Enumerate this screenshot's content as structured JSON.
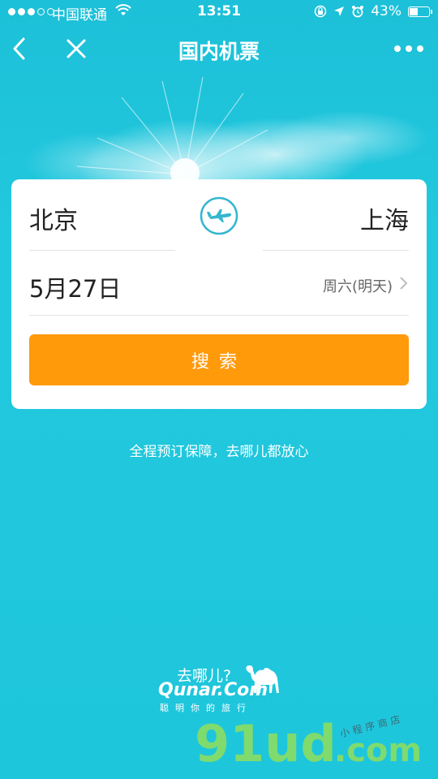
{
  "status_bar": {
    "carrier": "中国联通",
    "time": "13:51",
    "battery": "43%",
    "icons": [
      "signal-icon",
      "wifi-icon",
      "lock-rotation-icon",
      "location-icon",
      "alarm-icon",
      "battery-icon"
    ]
  },
  "nav": {
    "title": "国内机票",
    "back_icon": "chevron-left-icon",
    "close_icon": "close-icon",
    "more_icon": "more-dots-icon"
  },
  "search_card": {
    "from_city": "北京",
    "to_city": "上海",
    "swap_icon": "plane-swap-icon",
    "date": "5月27日",
    "weekday": "周六(明天)",
    "search_label": "搜索"
  },
  "slogan": "全程预订保障，去哪儿都放心",
  "brand": {
    "cn": "去哪儿?",
    "en": "Qunar.Com",
    "tagline": "聪明你的旅行"
  },
  "watermark": {
    "main": "91ud",
    "suffix": ".com",
    "small": "小程序商店"
  },
  "colors": {
    "background": "#1fc6dc",
    "accent": "#ff9a0b",
    "card": "#ffffff",
    "plane_icon": "#34b6cf"
  }
}
